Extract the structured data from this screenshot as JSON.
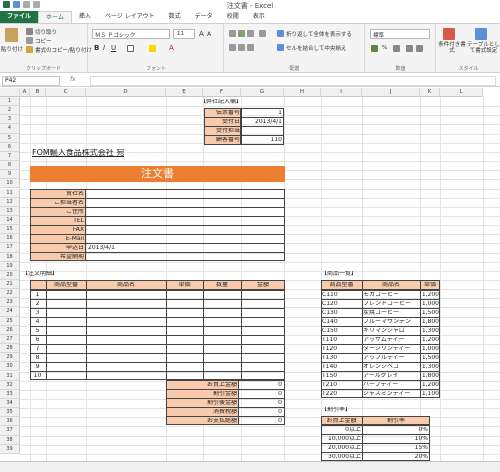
{
  "window": {
    "title": "注文書 - Excel"
  },
  "ribbon": {
    "tabs": [
      "ファイル",
      "ホーム",
      "挿入",
      "ページ レイアウト",
      "数式",
      "データ",
      "校閲",
      "表示"
    ],
    "paste_label": "貼り付け",
    "cut_label": "切り取り",
    "copy_label": "コピー",
    "format_painter_label": "書式のコピー/貼り付け",
    "clipboard_group": "クリップボード",
    "font_name": "ＭＳ Ｐゴシック",
    "font_size": "11",
    "font_group": "フォント",
    "wrap_text_label": "折り返して全体を表示する",
    "merge_center_label": "セルを結合して中央揃え",
    "alignment_group": "配置",
    "number_format": "標準",
    "number_group": "数値",
    "conditional_format_label": "条件付き書式",
    "format_as_table_label": "テーブルとして書式設定",
    "styles_group": "スタイル"
  },
  "formula_bar": {
    "name_box": "P42",
    "fx": "fx"
  },
  "grid": {
    "columns": [
      "A",
      "B",
      "C",
      "D",
      "E",
      "F",
      "G",
      "H",
      "I",
      "J",
      "K",
      "L"
    ],
    "rows": [
      "1",
      "2",
      "3",
      "4",
      "5",
      "6",
      "7",
      "8",
      "9",
      "10",
      "11",
      "12",
      "13",
      "14",
      "15",
      "16",
      "17",
      "18",
      "19",
      "20",
      "21",
      "22",
      "23",
      "24",
      "25",
      "26",
      "27",
      "28",
      "29",
      "30",
      "31",
      "32",
      "33",
      "34",
      "35",
      "36",
      "37",
      "38",
      "39"
    ]
  },
  "sheet": {
    "office_title": "【弊社記入欄】",
    "office_rows": [
      {
        "label": "伝票番号",
        "value": "1"
      },
      {
        "label": "受付日",
        "value": "2013/4/1"
      },
      {
        "label": "受付担当",
        "value": ""
      },
      {
        "label": "顧客番号",
        "value": "110"
      }
    ],
    "addressee": "FOM輸入食品株式会社 宛",
    "doc_title": "注文書",
    "customer_fields": [
      {
        "label": "貴社名",
        "value": ""
      },
      {
        "label": "ご担当者名",
        "value": ""
      },
      {
        "label": "ご住所",
        "value": ""
      },
      {
        "label": "TEL",
        "value": ""
      },
      {
        "label": "FAX",
        "value": ""
      },
      {
        "label": "E-Mail",
        "value": ""
      },
      {
        "label": "申込日",
        "value": "2013/4/1"
      },
      {
        "label": "希望納期",
        "value": ""
      }
    ],
    "detail_title": "【注文明細】",
    "detail_headers": [
      "商品型番",
      "商品名",
      "単価",
      "数量",
      "金額"
    ],
    "detail_rows": [
      "1",
      "2",
      "3",
      "4",
      "5",
      "6",
      "7",
      "8",
      "9",
      "10"
    ],
    "totals": [
      {
        "label": "お買上金額",
        "value": "0"
      },
      {
        "label": "割引金額",
        "value": "0"
      },
      {
        "label": "割引後金額",
        "value": "0"
      },
      {
        "label": "消費税額",
        "value": "0"
      },
      {
        "label": "お支払総額",
        "value": "0"
      }
    ],
    "product_title": "【商品一覧】",
    "product_headers": [
      "商品型番",
      "商品名",
      "単価"
    ],
    "products": [
      {
        "code": "C110",
        "name": "モカコーヒー",
        "price": "1,200"
      },
      {
        "code": "C120",
        "name": "ブレンドコーヒー",
        "price": "1,000"
      },
      {
        "code": "C130",
        "name": "炭焼コーヒー",
        "price": "1,500"
      },
      {
        "code": "C140",
        "name": "ブルーマウンテン",
        "price": "1,800"
      },
      {
        "code": "C150",
        "name": "キリマンジャロ",
        "price": "1,300"
      },
      {
        "code": "T110",
        "name": "アッサムティー",
        "price": "1,200"
      },
      {
        "code": "T120",
        "name": "ダージリンティー",
        "price": "1,000"
      },
      {
        "code": "T130",
        "name": "アップルティー",
        "price": "1,500"
      },
      {
        "code": "T140",
        "name": "オレンジペコ",
        "price": "1,300"
      },
      {
        "code": "T150",
        "name": "アールグレイ",
        "price": "1,800"
      },
      {
        "code": "T210",
        "name": "ハーブティー",
        "price": "1,200"
      },
      {
        "code": "T220",
        "name": "ジャスミンティー",
        "price": "1,100"
      }
    ],
    "discount_title": "【割引率】",
    "discount_headers": [
      "お買上金額",
      "割引率"
    ],
    "discounts": [
      {
        "amount": "0以上",
        "rate": "0%"
      },
      {
        "amount": "10,000以上",
        "rate": "10%"
      },
      {
        "amount": "20,000以上",
        "rate": "15%"
      },
      {
        "amount": "30,000以上",
        "rate": "20%"
      }
    ]
  },
  "colors": {
    "excel_green": "#217346",
    "title_orange": "#ed7d31",
    "header_peach": "#f8cbad"
  }
}
